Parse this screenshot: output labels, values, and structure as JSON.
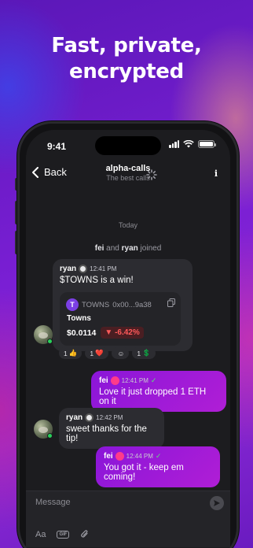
{
  "headline": {
    "line1": "Fast, private,",
    "line2": "encrypted"
  },
  "status_bar": {
    "time": "9:41"
  },
  "nav": {
    "back_label": "Back",
    "title": "alpha-calls",
    "subtitle": "The best calls",
    "info_label": "i"
  },
  "chat": {
    "day_divider": "Today",
    "joined": {
      "user1": "fei",
      "and": " and ",
      "user2": "ryan",
      "suffix": " joined"
    },
    "messages": [
      {
        "author": "ryan",
        "time": "12:41 PM",
        "text": "$TOWNS is a win!",
        "token": {
          "logo": "T",
          "symbol": "TOWNS",
          "address": "0x00...9a38",
          "name": "Towns",
          "price": "$0.0114",
          "change": "-6.42%"
        },
        "reactions": [
          {
            "count": "1",
            "emoji": "👍"
          },
          {
            "count": "1",
            "emoji": "❤️"
          },
          {
            "count": "",
            "emoji": "☺"
          },
          {
            "count": "1",
            "emoji": "💲"
          }
        ]
      },
      {
        "author": "fei",
        "time": "12:41 PM",
        "text": "Love it just dropped 1 ETH on it",
        "check": "✓"
      },
      {
        "author": "ryan",
        "time": "12:42 PM",
        "text": "sweet thanks for the tip!"
      },
      {
        "author": "fei",
        "time": "12:44 PM",
        "text": "You got it - keep em coming!",
        "check": "✓"
      }
    ]
  },
  "composer": {
    "placeholder": "Message",
    "tools": {
      "format": "Aa",
      "gif": "GIF"
    }
  },
  "colors": {
    "accent": "#a01cd6",
    "online": "#28d05a",
    "negative": "#ff5a5a"
  }
}
